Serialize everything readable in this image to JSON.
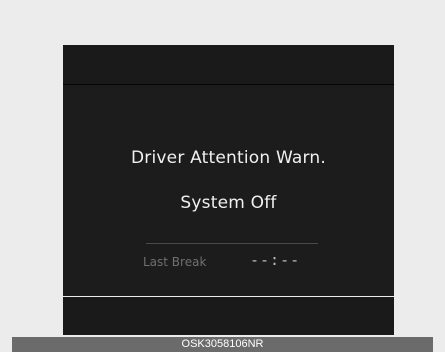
{
  "display": {
    "message_line1": "Driver Attention Warn.",
    "message_line2": "System Off",
    "last_break_label": "Last Break",
    "last_break_value": "--:--"
  },
  "caption": {
    "code": "OSK3058106NR"
  },
  "colors": {
    "page_background": "#ececec",
    "display_background": "#1a1a1a",
    "primary_text": "#f0f0f0",
    "dim_text": "#6f6f6f",
    "caption_bar": "#6b6b6b"
  }
}
